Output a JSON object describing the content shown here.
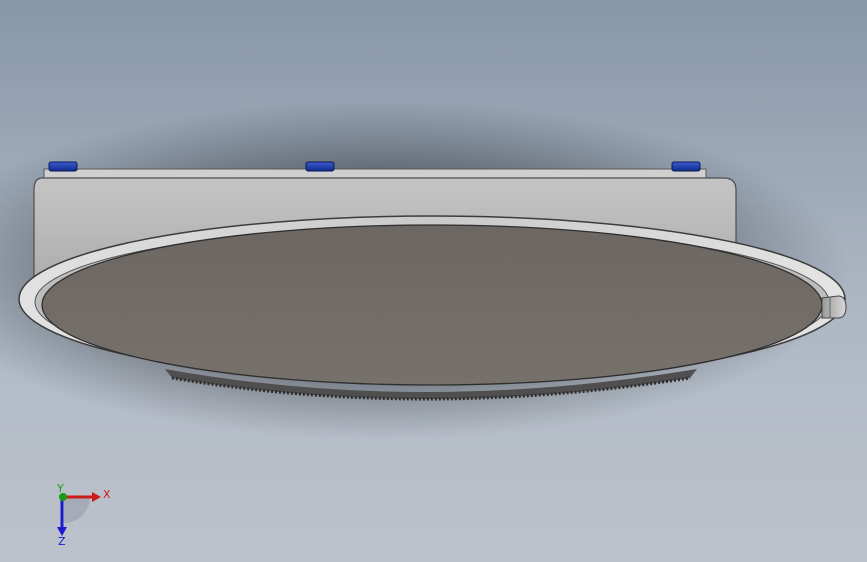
{
  "viewport": {
    "background_top": "#8797aa",
    "background_bottom": "#bcc2cb"
  },
  "model": {
    "face_color": "#716b67",
    "body_color": "#b4b4b4",
    "rim_color": "#d2d2d2",
    "knurl_color": "#4f4f4f",
    "fastener_color": "#1f3fa8",
    "fastener_count": 3
  },
  "triad": {
    "x_label": "X",
    "y_label": "Y",
    "z_label": "Z",
    "x_color": "#cc1b1b",
    "y_color": "#1a9a1a",
    "z_color": "#1b1bcc"
  }
}
